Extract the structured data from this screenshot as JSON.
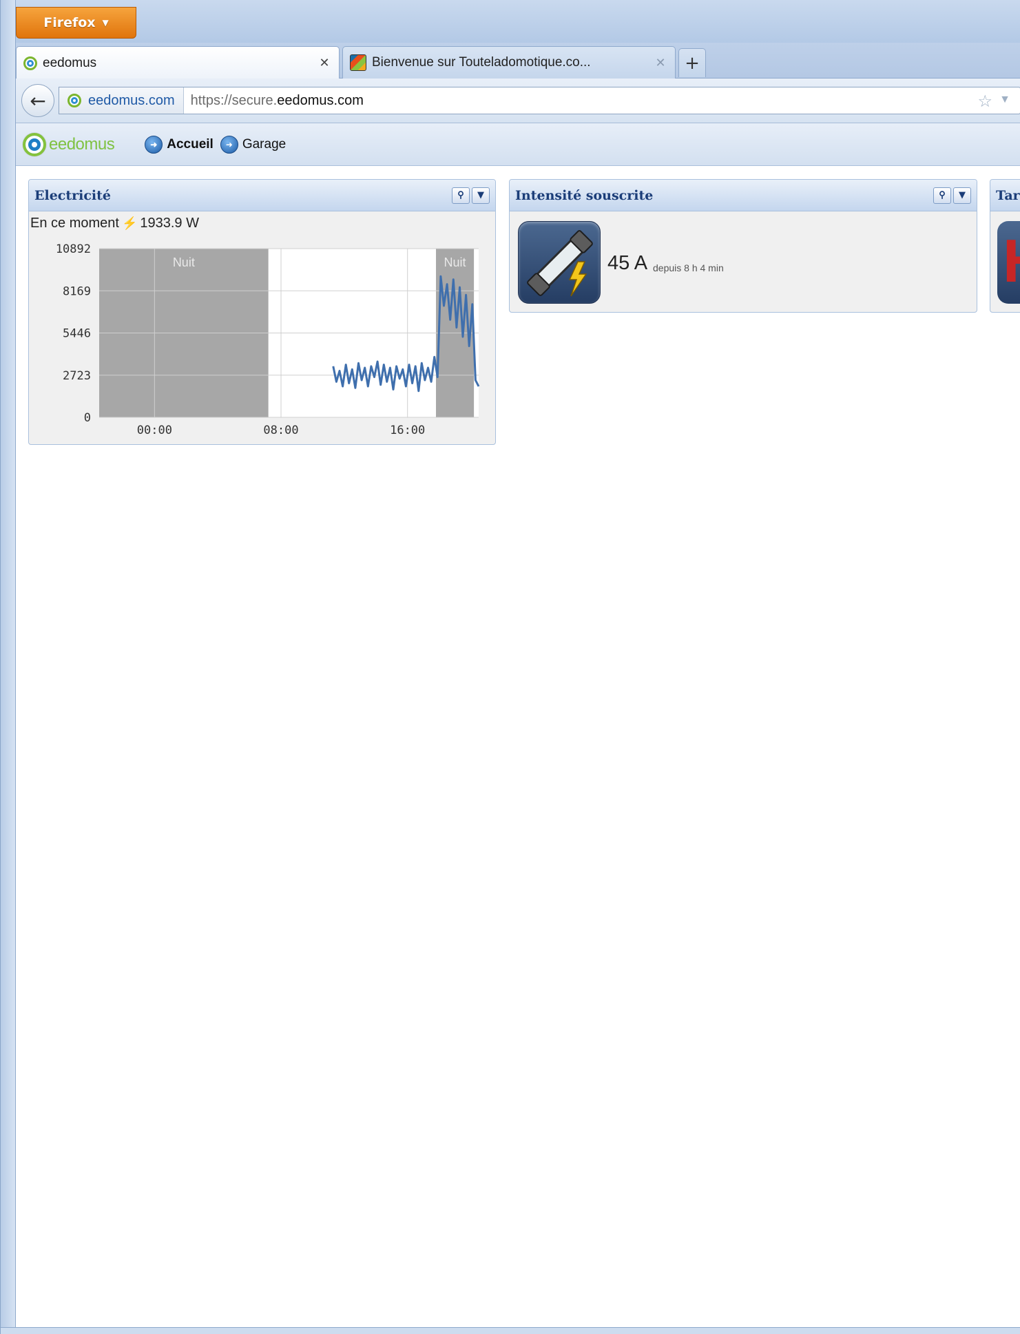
{
  "browser": {
    "menu_label": "Firefox",
    "tabs": [
      {
        "title": "eedomus",
        "active": true
      },
      {
        "title": "Bienvenue sur Touteladomotique.co...",
        "active": false
      }
    ],
    "new_tab_label": "+",
    "urlbar": {
      "identity": "eedomus.com",
      "url_prefix": "https://secure.",
      "url_domain": "eedomus.com"
    }
  },
  "app": {
    "logo_text": "eedomus",
    "nav": [
      {
        "label": "Accueil"
      },
      {
        "label": "Garage"
      }
    ]
  },
  "widgets": {
    "electricite": {
      "title": "Electricité",
      "now_label": "En ce moment",
      "now_value": "1933.9 W"
    },
    "intensite": {
      "title": "Intensité souscrite",
      "value": "45 A",
      "since": "depuis 8 h 4 min"
    },
    "tarif": {
      "title": "Tar",
      "icon_letter": "H"
    }
  },
  "colors": {
    "accent": "#1b3d78",
    "series": "#3f6fad",
    "night_band": "#a7a7a7",
    "firefox_orange": "#e98114"
  },
  "chart_data": {
    "type": "line",
    "title": "",
    "xlabel": "",
    "ylabel": "",
    "x_ticks": [
      "00:00",
      "08:00",
      "16:00"
    ],
    "y_ticks": [
      0,
      2723,
      5446,
      8169,
      10892
    ],
    "ylim": [
      0,
      10892
    ],
    "xlim_hours": [
      -3.5,
      20.5
    ],
    "bands": [
      {
        "label": "Nuit",
        "from": -3.5,
        "to": 7.2
      },
      {
        "label": "Nuit",
        "from": 17.8,
        "to": 20.2
      }
    ],
    "series": [
      {
        "x": [
          11.3,
          11.5,
          11.7,
          11.9,
          12.1,
          12.3,
          12.5,
          12.7,
          12.9,
          13.1,
          13.3,
          13.5,
          13.7,
          13.9,
          14.1,
          14.3,
          14.5,
          14.7,
          14.9,
          15.1,
          15.3,
          15.5,
          15.7,
          15.9,
          16.1,
          16.3,
          16.5,
          16.7,
          16.9,
          17.1,
          17.3,
          17.5,
          17.7,
          17.9,
          18.1,
          18.3,
          18.5,
          18.7,
          18.9,
          19.1,
          19.3,
          19.5,
          19.7,
          19.9,
          20.1,
          20.3,
          20.5
        ],
        "y": [
          3300,
          2300,
          3000,
          2000,
          3400,
          2200,
          3100,
          1900,
          3500,
          2400,
          3200,
          2000,
          3300,
          2600,
          3600,
          2100,
          3400,
          2300,
          3200,
          1800,
          3300,
          2500,
          3100,
          2000,
          3400,
          2200,
          3300,
          1700,
          3500,
          2400,
          3200,
          2300,
          3900,
          2600,
          9100,
          7200,
          8600,
          6300,
          8900,
          5800,
          8400,
          5200,
          7900,
          4600,
          7300,
          2400,
          2000
        ]
      }
    ],
    "grid": true,
    "legend": "none"
  }
}
